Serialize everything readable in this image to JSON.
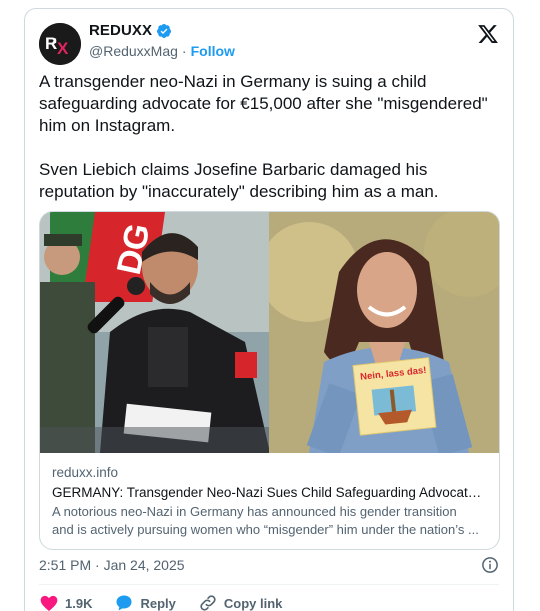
{
  "author": {
    "display_name": "REDUXX",
    "handle": "@ReduxxMag",
    "separator": "·",
    "follow_label": "Follow",
    "verified": true,
    "avatar_text": "RX"
  },
  "tweet": {
    "paragraph_1": "A transgender neo-Nazi in Germany is suing a child safeguarding advocate for €15,000 after she \"misgendered\" him on Instagram.",
    "paragraph_2": "Sven Liebich claims Josefine Barbaric damaged his reputation by \"inaccurately\" describing him as a man."
  },
  "link_card": {
    "domain": "reduxx.info",
    "title": "GERMANY: Transgender Neo-Nazi Sues Child Safeguarding Advocate Fo...",
    "description_line_1": "A notorious neo-Nazi in Germany has announced his gender transition",
    "description_line_2": "and is actively pursuing women who “misgender” him under the nation’s ...",
    "left_image_banner_text": "DG",
    "right_image_book_title": "Nein, lass das!"
  },
  "meta": {
    "timestamp": "2:51 PM · Jan 24, 2025"
  },
  "actions": {
    "likes": "1.9K",
    "reply_label": "Reply",
    "copy_label": "Copy link"
  },
  "colors": {
    "accent": "#1d9bf0",
    "like_red": "#f91880",
    "muted": "#536471",
    "border": "#cfd9de"
  },
  "icons": [
    "verified-badge-icon",
    "x-logo-icon",
    "info-icon",
    "heart-icon",
    "reply-bubble-icon",
    "link-icon"
  ]
}
